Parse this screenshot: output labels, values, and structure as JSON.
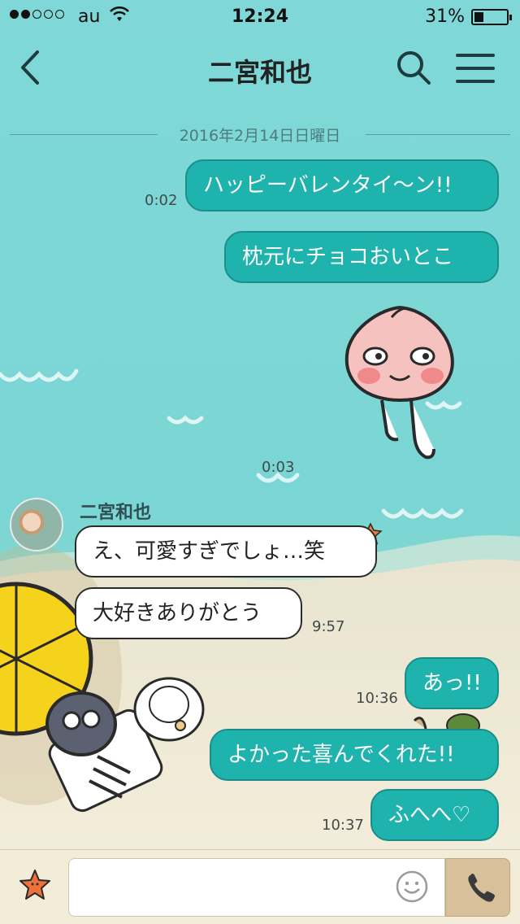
{
  "status_bar": {
    "carrier": "au",
    "time": "12:24",
    "battery": "31%"
  },
  "nav": {
    "title": "二宮和也",
    "back_icon": "chevron-left-icon",
    "search_icon": "search-icon",
    "menu_icon": "hamburger-menu-icon"
  },
  "date_divider": "2016年2月14日日曜日",
  "messages": [
    {
      "from": "me",
      "text": "ハッピーバレンタイ〜ン!!",
      "time": "0:02"
    },
    {
      "from": "me",
      "text": "枕元にチョコおいとこ",
      "time": ""
    },
    {
      "from": "me",
      "sticker": "peach-character-sticker",
      "time": "0:03"
    },
    {
      "from": "them",
      "sender": "二宮和也",
      "text": "え、可愛すぎでしょ…笑",
      "time": ""
    },
    {
      "from": "them",
      "text": "大好きありがとう",
      "time": "9:57"
    },
    {
      "from": "me",
      "text": "あっ!!",
      "time": "10:36"
    },
    {
      "from": "me",
      "text": "よかった喜んでくれた!!",
      "time": ""
    },
    {
      "from": "me",
      "text": "ふへへ♡",
      "time": "10:37"
    }
  ],
  "input": {
    "placeholder": "",
    "star_icon": "starfish-icon",
    "emoji_icon": "smiley-icon",
    "call_icon": "phone-icon"
  },
  "colors": {
    "sea": "#7ed8d6",
    "my_bubble": "#1fb3ad",
    "their_bubble": "#ffffff",
    "sand": "#f4eedc",
    "call_button": "#d8c19a"
  }
}
